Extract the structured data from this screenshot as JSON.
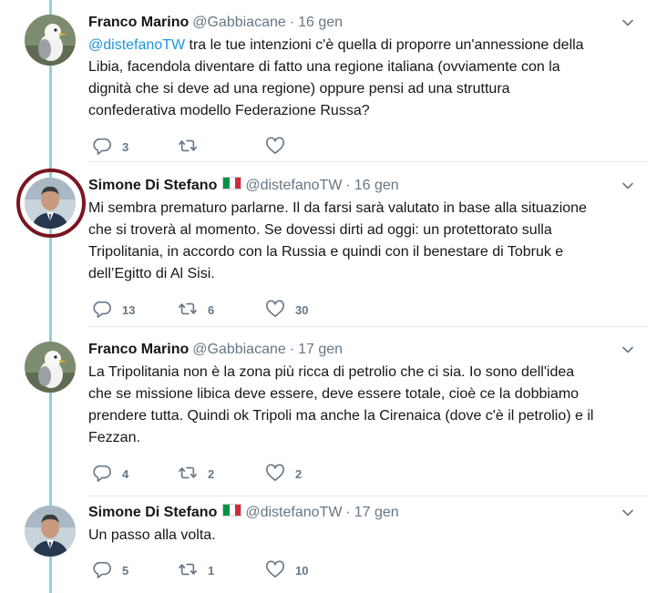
{
  "thread": {
    "tweets": [
      {
        "author_name": "Franco Marino",
        "handle": "@Gabbiacane",
        "separator": "·",
        "date": "16 gen",
        "has_flag": false,
        "avatar_icon": "seagull-avatar",
        "lines": [
          {
            "mention": "@distefanoTW",
            "text": " tra le tue intenzioni c'è quella di proporre un'annessione della"
          },
          {
            "mention": "",
            "text": "Libia, facendola diventare di fatto una regione italiana (ovviamente con la"
          },
          {
            "mention": "",
            "text": "dignità che si deve ad una regione) oppure pensi ad una struttura"
          },
          {
            "mention": "",
            "text": "confederativa modello Federazione Russa?"
          }
        ],
        "replies": "3",
        "retweets": "",
        "likes": ""
      },
      {
        "author_name": "Simone Di Stefano",
        "handle": "@distefanoTW",
        "separator": "·",
        "date": "16 gen",
        "has_flag": true,
        "avatar_icon": "person-avatar",
        "lines": [
          {
            "mention": "",
            "text": "Mi sembra prematuro parlarne. Il da farsi sarà valutato in base alla situazione"
          },
          {
            "mention": "",
            "text": "che si troverà al momento.  Se dovessi dirti ad oggi: un protettorato sulla"
          },
          {
            "mention": "",
            "text": "Tripolitania, in accordo con la Russia e quindi con il benestare di Tobruk e"
          },
          {
            "mention": "",
            "text": "dell’Egitto di Al Sisi."
          }
        ],
        "replies": "13",
        "retweets": "6",
        "likes": "30"
      },
      {
        "author_name": "Franco Marino",
        "handle": "@Gabbiacane",
        "separator": "·",
        "date": "17 gen",
        "has_flag": false,
        "avatar_icon": "seagull-avatar",
        "lines": [
          {
            "mention": "",
            "text": "La Tripolitania non è la zona più ricca di petrolio che ci sia. Io sono dell'idea"
          },
          {
            "mention": "",
            "text": "che se missione libica deve essere, deve essere totale, cioè ce la dobbiamo"
          },
          {
            "mention": "",
            "text": "prendere tutta. Quindi ok Tripoli ma anche la Cirenaica (dove c'è il petrolio) e il"
          },
          {
            "mention": "",
            "text": "Fezzan."
          }
        ],
        "replies": "4",
        "retweets": "2",
        "likes": "2"
      },
      {
        "author_name": "Simone Di Stefano",
        "handle": "@distefanoTW",
        "separator": "·",
        "date": "17 gen",
        "has_flag": true,
        "avatar_icon": "person-avatar",
        "lines": [
          {
            "mention": "",
            "text": "Un passo alla volta."
          }
        ],
        "replies": "5",
        "retweets": "1",
        "likes": "10"
      }
    ]
  },
  "colors": {
    "thread_line": "#8fd1e1",
    "highlight_ring": "#7a1621",
    "mention": "#1b95e0",
    "muted": "#657786",
    "flag_green": "#009246",
    "flag_white": "#ffffff",
    "flag_red": "#ce2b37"
  }
}
